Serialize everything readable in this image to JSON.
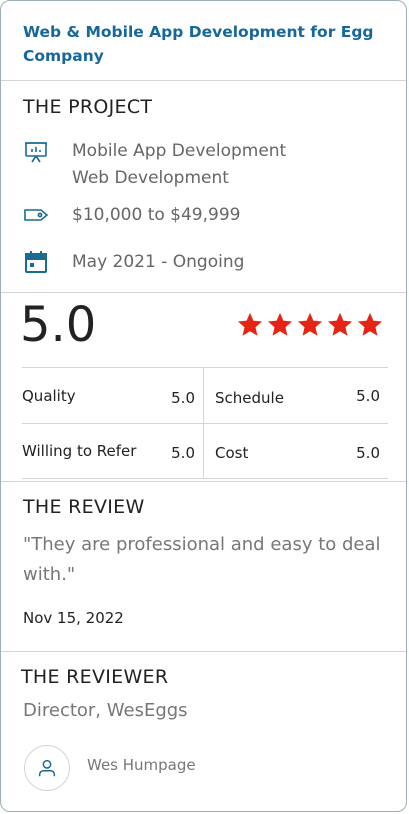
{
  "header": {
    "title": "Web & Mobile App Development for Egg Company"
  },
  "project": {
    "heading": "THE PROJECT",
    "services": [
      "Mobile App Development",
      "Web Development"
    ],
    "budget": "$10,000 to $49,999",
    "timeline": "May 2021 - Ongoing"
  },
  "rating": {
    "score": "5.0",
    "stars": 5,
    "star_color": "#e62415",
    "scores": [
      {
        "label": "Quality",
        "value": "5.0"
      },
      {
        "label": "Schedule",
        "value": "5.0"
      },
      {
        "label": "Willing to Refer",
        "value": "5.0"
      },
      {
        "label": "Cost",
        "value": "5.0"
      }
    ]
  },
  "review": {
    "heading": "THE REVIEW",
    "quote": "\"They are professional and easy to deal with.\"",
    "date": "Nov 15, 2022"
  },
  "reviewer": {
    "heading": "THE REVIEWER",
    "role": "Director, WesEggs",
    "name": "Wes Humpage"
  },
  "colors": {
    "accent": "#17689a",
    "icon": "#1a6a92",
    "border": "#cfd5d8"
  }
}
